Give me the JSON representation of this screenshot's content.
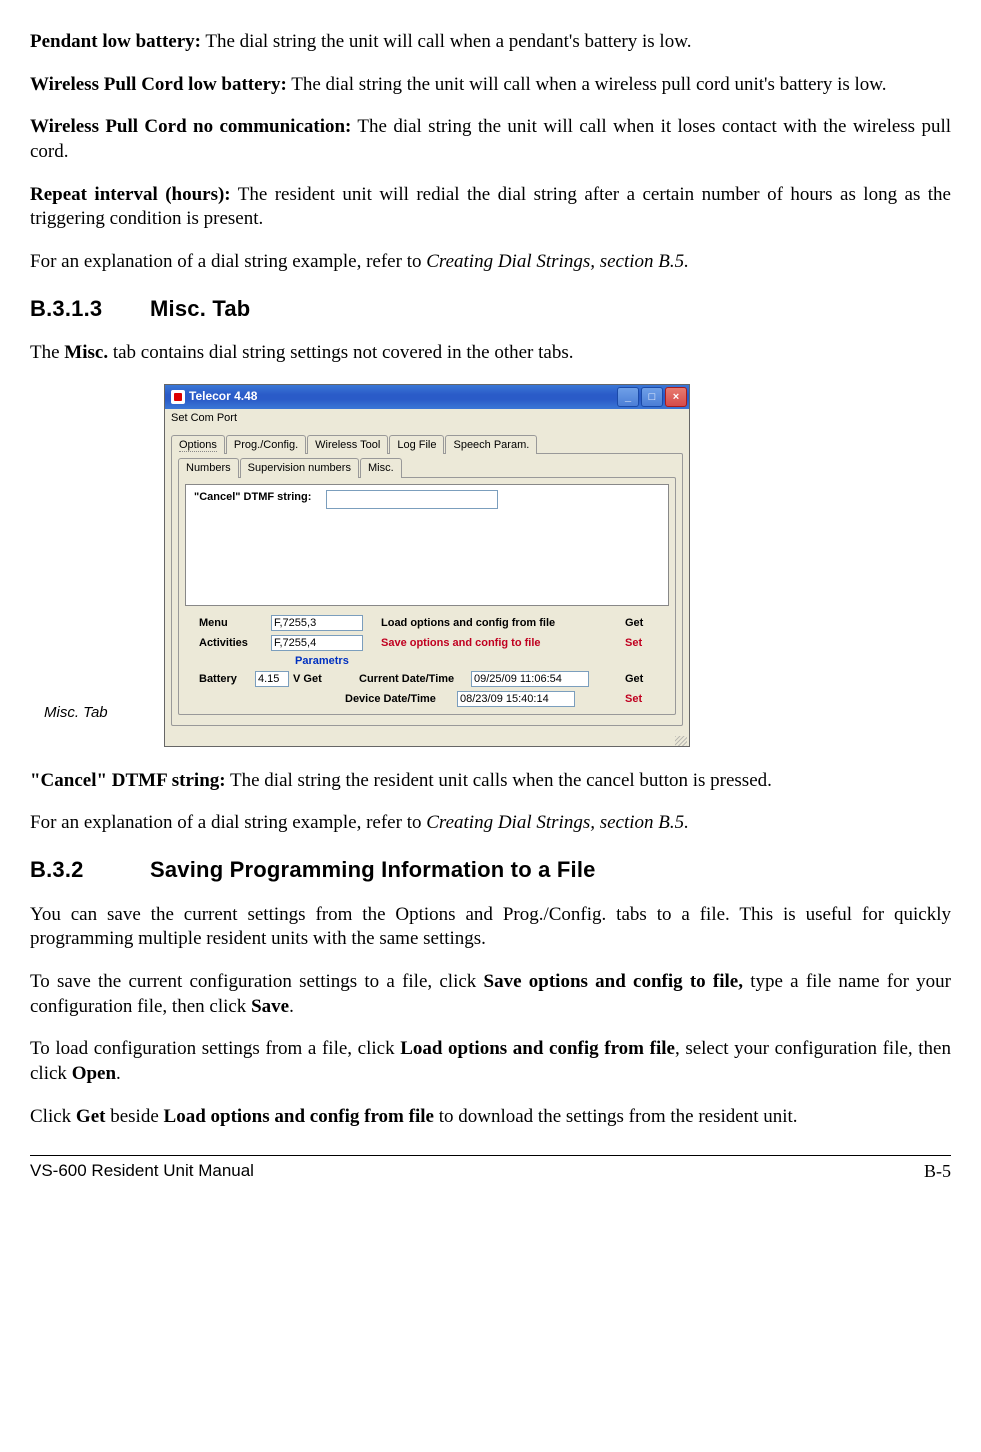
{
  "defs": {
    "pendant_low": {
      "label": "Pendant low battery:",
      "text": " The dial string the unit will call when a pendant's battery is low."
    },
    "wpc_low": {
      "label": "Wireless Pull Cord low battery:",
      "text": " The dial string the unit will call when a wireless pull cord unit's battery is low."
    },
    "wpc_nocom": {
      "label": "Wireless Pull Cord no communication:",
      "text": " The dial string the unit will call when it loses contact with the wireless pull cord."
    },
    "repeat": {
      "label": "Repeat interval (hours):",
      "text": " The resident unit will redial the dial string after a certain number of hours as long as the triggering condition is present."
    },
    "xref1": {
      "pre": "For an explanation of a dial string example, refer to ",
      "ref": "Creating Dial Strings, section B.5."
    }
  },
  "sec313": {
    "num": "B.3.1.3",
    "title": "Misc. Tab",
    "intro_pre": "The ",
    "intro_bold": "Misc.",
    "intro_post": " tab contains dial string settings not covered in the other tabs."
  },
  "fig": {
    "caption": "Misc. Tab"
  },
  "window": {
    "title": "Telecor 4.48",
    "menubar": "Set Com Port",
    "tabs1": [
      "Options",
      "Prog./Config.",
      "Wireless Tool",
      "Log File",
      "Speech Param."
    ],
    "tabs2": [
      "Numbers",
      "Supervision numbers",
      "Misc."
    ],
    "cancel_label": "\"Cancel\" DTMF string:",
    "menu_label": "Menu",
    "activities_label": "Activities",
    "menu_val": "F,7255,3",
    "activities_val": "F,7255,4",
    "load_label": "Load  options and config from file",
    "save_label": "Save options and config to file",
    "get": "Get",
    "set": "Set",
    "params_label": "Parametrs",
    "battery_label": "Battery",
    "battery_val": "4.15",
    "battery_unit": "V   Get",
    "curr_dt_label": "Current Date/Time",
    "dev_dt_label": "Device Date/Time",
    "curr_dt_val": "09/25/09   11:06:54",
    "dev_dt_val": "08/23/09   15:40:14"
  },
  "cancel_def": {
    "label": "\"Cancel\" DTMF string:",
    "text": " The dial string the resident unit calls when the cancel button is pressed."
  },
  "xref2": {
    "pre": "For an explanation of a dial string example, refer to ",
    "ref": "Creating Dial Strings, section B.5."
  },
  "sec32": {
    "num": "B.3.2",
    "title": "Saving Programming Information to a File"
  },
  "p32a": "You can save the current settings from the Options and Prog./Config. tabs to a file.  This is useful for quickly programming multiple resident units with the same settings.",
  "p32b": {
    "t1": "To save the current configuration settings to a file, click ",
    "b1": "Save options and config to file,",
    "t2": " type a file name for your configuration file, then click ",
    "b2": "Save",
    "t3": "."
  },
  "p32c": {
    "t1": "To load configuration settings from a file, click ",
    "b1": "Load options and config from file",
    "t2": ", select your configuration file, then click ",
    "b2": "Open",
    "t3": "."
  },
  "p32d": {
    "t1": "Click ",
    "b1": "Get",
    "t2": " beside ",
    "b2": "Load options and config from file",
    "t3": " to download the settings from the resident unit."
  },
  "footer": {
    "left": "VS-600 Resident Unit Manual",
    "right": "B-5"
  }
}
